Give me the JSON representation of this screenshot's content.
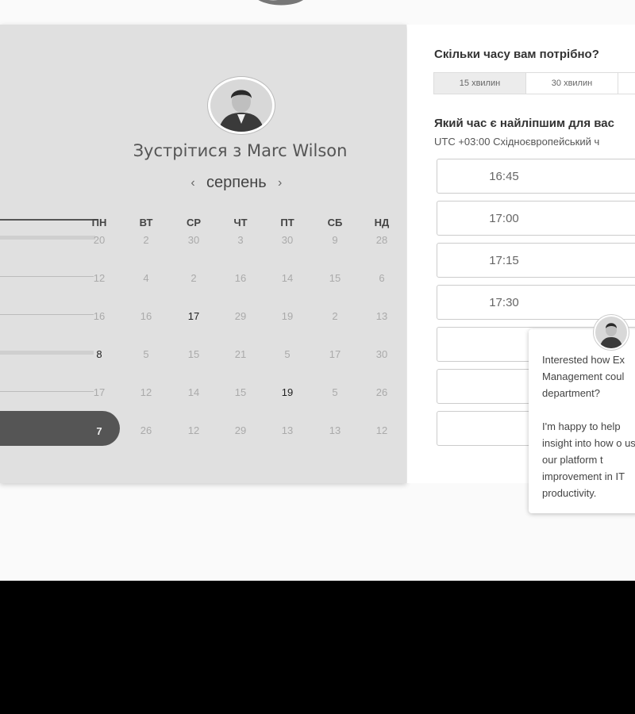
{
  "meeting_title": "Зустрітися з Marc Wilson",
  "month": "серпень",
  "weekdays": [
    "ПН",
    "ВТ",
    "СР",
    "ЧТ",
    "ПТ",
    "СБ",
    "НД"
  ],
  "calendar_rows": [
    [
      "20",
      "2",
      "30",
      "3",
      "30",
      "9",
      "28"
    ],
    [
      "12",
      "4",
      "2",
      "16",
      "14",
      "15",
      "6"
    ],
    [
      "16",
      "16",
      "17",
      "29",
      "19",
      "2",
      "13"
    ],
    [
      "8",
      "5",
      "15",
      "21",
      "5",
      "17",
      "30"
    ],
    [
      "17",
      "12",
      "14",
      "15",
      "19",
      "5",
      "26"
    ],
    [
      "7",
      "26",
      "12",
      "29",
      "13",
      "13",
      "12"
    ]
  ],
  "duration_question": "Скільки часу вам потрібно?",
  "durations": [
    "15 хвилин",
    "30 хвилин",
    ""
  ],
  "time_question": "Який час є найліпшим для вас",
  "timezone": "UTC +03:00 Східноєвропейський ч",
  "time_slots": [
    "16:45",
    "17:00",
    "17:15",
    "17:30",
    "",
    "",
    "",
    ""
  ],
  "chat_message_p1": "Interested how Ex Management coul department?",
  "chat_message_p2": "I'm happy to help insight into how o use our platform t improvement in IT productivity."
}
